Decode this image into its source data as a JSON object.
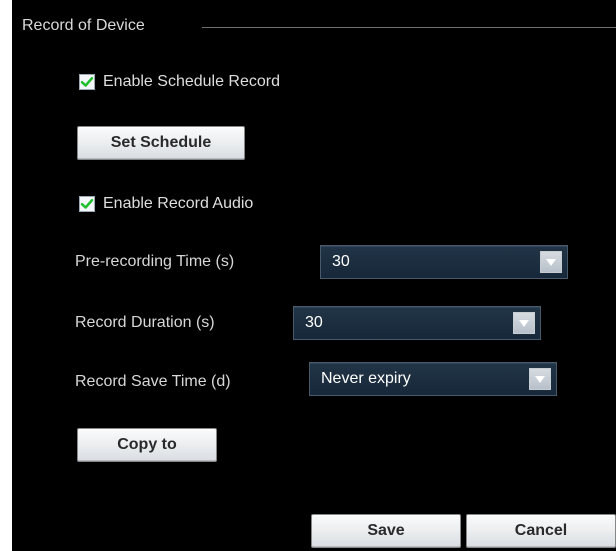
{
  "section": {
    "title": "Record of Device"
  },
  "options": {
    "enable_schedule_record": {
      "label": "Enable Schedule Record",
      "checked": true
    },
    "enable_record_audio": {
      "label": "Enable Record Audio",
      "checked": true
    }
  },
  "buttons": {
    "set_schedule": "Set Schedule",
    "copy_to": "Copy to",
    "save": "Save",
    "cancel": "Cancel"
  },
  "fields": {
    "pre_recording_time": {
      "label": "Pre-recording Time (s)",
      "value": "30"
    },
    "record_duration": {
      "label": "Record Duration (s)",
      "value": "30"
    },
    "record_save_time": {
      "label": "Record Save Time (d)",
      "value": "Never expiry"
    }
  },
  "icons": {
    "checkmark": "check-icon",
    "dropdown": "chevron-down-icon"
  },
  "colors": {
    "panel_background": "#000000",
    "text": "#d7d7d7",
    "checkbox_check": "#1fbe2d",
    "select_background": "#1b2d3e",
    "button_face": "#eceef0"
  }
}
